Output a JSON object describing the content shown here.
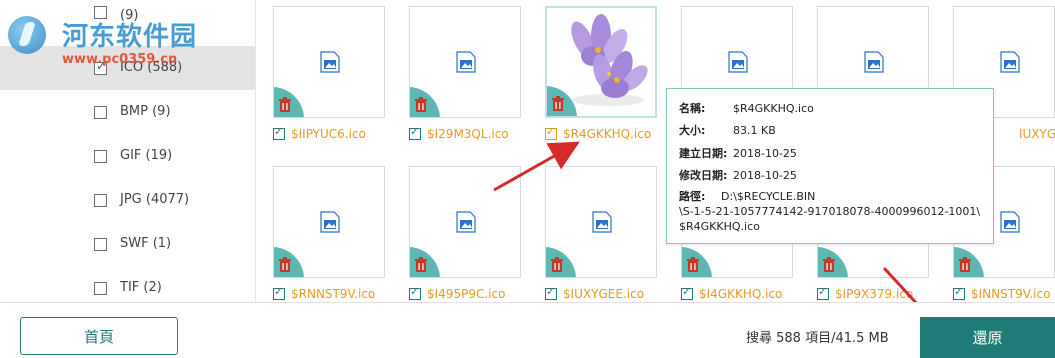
{
  "sidebar": {
    "items": [
      {
        "label": "ICO (588)",
        "checked": true,
        "selected": true
      },
      {
        "label": "BMP (9)",
        "checked": false
      },
      {
        "label": "GIF (19)",
        "checked": false
      },
      {
        "label": "JPG (4077)",
        "checked": false
      },
      {
        "label": "SWF (1)",
        "checked": false
      },
      {
        "label": "TIF (2)",
        "checked": false
      }
    ],
    "partial_top_label": "(9)"
  },
  "watermark": {
    "title": "河东软件园",
    "url": "www.pc0359.cn"
  },
  "grid": {
    "row1": [
      "$IIPYUC6.ico",
      "$I29M3QL.ico",
      "$R4GKKHQ.ico",
      "",
      "",
      "$IUXYGEE.ico"
    ],
    "row1_partial": "IUXYGEE.ico",
    "row2": [
      "$RNNST9V.ico",
      "$I495P9C.ico",
      "$IUXYGEE.ico",
      "$I4GKKHQ.ico",
      "$IP9X379.ico",
      "$INNST9V.ico"
    ]
  },
  "tooltip": {
    "name_key": "名稱:",
    "name_val": "$R4GKKHQ.ico",
    "size_key": "大小:",
    "size_val": "83.1 KB",
    "created_key": "建立日期:",
    "created_val": "2018-10-25",
    "modified_key": "修改日期:",
    "modified_val": "2018-10-25",
    "path_key": "路徑:",
    "path_line1": "D:\\$RECYCLE.BIN",
    "path_line2": "\\S-1-5-21-1057774142-917018078-4000996012-1001\\",
    "path_line3": "$R4GKKHQ.ico"
  },
  "footer": {
    "home_label": "首頁",
    "status": "搜尋 588 項目/41.5 MB",
    "restore_label": "還原"
  },
  "colors": {
    "accent": "#1f7c77",
    "filename": "#e79b24",
    "corner": "#5db7b2",
    "arrow": "#d42a2a"
  },
  "icons": {
    "image_placeholder": "image-file-icon",
    "delete": "trash-icon"
  }
}
